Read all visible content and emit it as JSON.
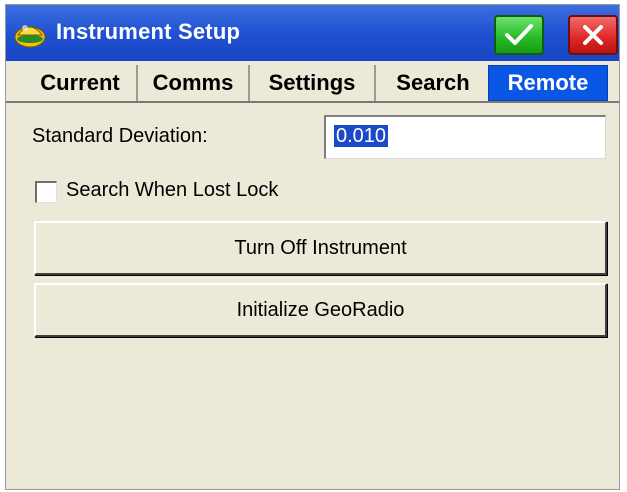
{
  "window": {
    "title": "Instrument Setup"
  },
  "title_buttons": {
    "ok_icon": "checkmark-icon",
    "close_icon": "close-icon"
  },
  "tabs": [
    {
      "label": "Current"
    },
    {
      "label": "Comms"
    },
    {
      "label": "Settings"
    },
    {
      "label": "Search"
    },
    {
      "label": "Remote",
      "active": true
    }
  ],
  "form": {
    "std_dev_label": "Standard Deviation:",
    "std_dev_value": "0.010",
    "search_lost_lock_label": "Search When Lost Lock",
    "search_lost_lock_checked": false
  },
  "buttons": {
    "turn_off": "Turn Off Instrument",
    "init_radio": "Initialize GeoRadio"
  },
  "colors": {
    "titlebar": "#1f4fd0",
    "active_tab": "#0a57e6",
    "ok_button": "#27b827",
    "close_button": "#e02626",
    "background": "#ece9d8"
  }
}
